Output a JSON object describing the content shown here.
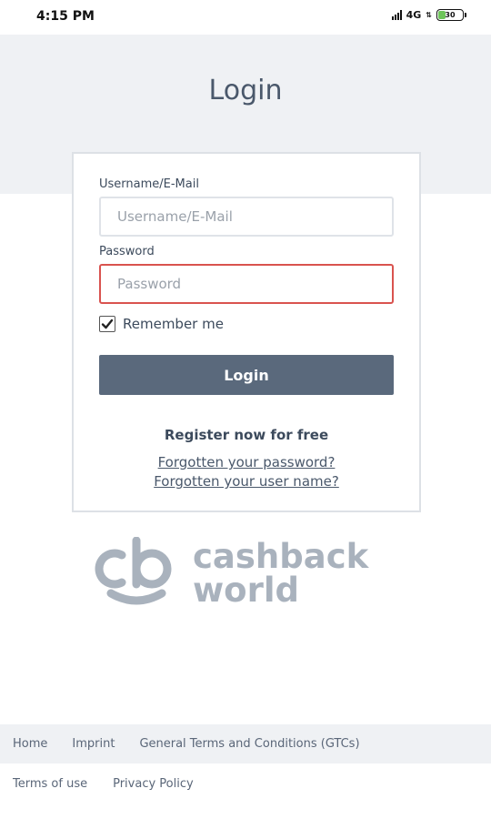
{
  "status_bar": {
    "time": "4:15 PM",
    "network": "4G",
    "battery": "30",
    "battery_level": 0.3
  },
  "page": {
    "title": "Login"
  },
  "form": {
    "username_label": "Username/E-Mail",
    "username_placeholder": "Username/E-Mail",
    "password_label": "Password",
    "password_placeholder": "Password",
    "remember_label": "Remember me",
    "remember_checked": true,
    "login_button": "Login",
    "register_link": "Register now for free",
    "forgot_password_link": "Forgotten your password?",
    "forgot_username_link": "Forgotten your user name?"
  },
  "logo": {
    "line1": "cashback",
    "line2": "world",
    "color": "#a9b2bd"
  },
  "footer": {
    "row1": [
      "Home",
      "Imprint",
      "General Terms and Conditions (GTCs)"
    ],
    "row2": [
      "Terms of use",
      "Privacy Policy"
    ]
  },
  "colors": {
    "button": "#5a697c",
    "error_border": "#d9534f",
    "header_band": "#eff1f4"
  }
}
